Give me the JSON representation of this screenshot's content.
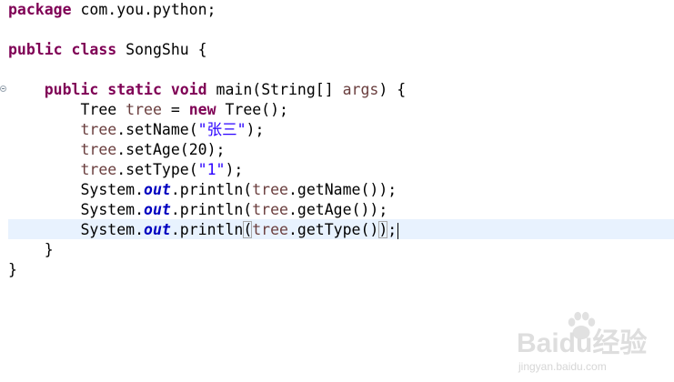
{
  "editor": {
    "lines": [
      {
        "segments": [
          {
            "t": "package",
            "c": "kw"
          },
          {
            "t": " com.you.python;",
            "c": "plain"
          }
        ]
      },
      {
        "segments": []
      },
      {
        "segments": [
          {
            "t": "public",
            "c": "kw"
          },
          {
            "t": " ",
            "c": "plain"
          },
          {
            "t": "class",
            "c": "kw"
          },
          {
            "t": " SongShu {",
            "c": "plain"
          }
        ]
      },
      {
        "segments": []
      },
      {
        "segments": [
          {
            "t": "    ",
            "c": "plain"
          },
          {
            "t": "public",
            "c": "kw"
          },
          {
            "t": " ",
            "c": "plain"
          },
          {
            "t": "static",
            "c": "kw"
          },
          {
            "t": " ",
            "c": "plain"
          },
          {
            "t": "void",
            "c": "kw"
          },
          {
            "t": " main(String[] ",
            "c": "plain"
          },
          {
            "t": "args",
            "c": "field"
          },
          {
            "t": ") {",
            "c": "plain"
          }
        ]
      },
      {
        "segments": [
          {
            "t": "        Tree ",
            "c": "plain"
          },
          {
            "t": "tree",
            "c": "field"
          },
          {
            "t": " = ",
            "c": "plain"
          },
          {
            "t": "new",
            "c": "kw"
          },
          {
            "t": " Tree();",
            "c": "plain"
          }
        ]
      },
      {
        "segments": [
          {
            "t": "        ",
            "c": "plain"
          },
          {
            "t": "tree",
            "c": "field"
          },
          {
            "t": ".setName(",
            "c": "plain"
          },
          {
            "t": "\"张三\"",
            "c": "str"
          },
          {
            "t": ");",
            "c": "plain"
          }
        ]
      },
      {
        "segments": [
          {
            "t": "        ",
            "c": "plain"
          },
          {
            "t": "tree",
            "c": "field"
          },
          {
            "t": ".setAge(20);",
            "c": "plain"
          }
        ]
      },
      {
        "segments": [
          {
            "t": "        ",
            "c": "plain"
          },
          {
            "t": "tree",
            "c": "field"
          },
          {
            "t": ".setType(",
            "c": "plain"
          },
          {
            "t": "\"1\"",
            "c": "str"
          },
          {
            "t": ");",
            "c": "plain"
          }
        ]
      },
      {
        "segments": [
          {
            "t": "        System.",
            "c": "plain"
          },
          {
            "t": "out",
            "c": "static-field"
          },
          {
            "t": ".println(",
            "c": "plain"
          },
          {
            "t": "tree",
            "c": "field"
          },
          {
            "t": ".getName());",
            "c": "plain"
          }
        ]
      },
      {
        "segments": [
          {
            "t": "        System.",
            "c": "plain"
          },
          {
            "t": "out",
            "c": "static-field"
          },
          {
            "t": ".println(",
            "c": "plain"
          },
          {
            "t": "tree",
            "c": "field"
          },
          {
            "t": ".getAge());",
            "c": "plain"
          }
        ]
      },
      {
        "segments": [
          {
            "t": "        System.",
            "c": "plain"
          },
          {
            "t": "out",
            "c": "static-field"
          },
          {
            "t": ".println",
            "c": "plain"
          },
          {
            "t": "(",
            "c": "plain"
          },
          {
            "t": "tree",
            "c": "field"
          },
          {
            "t": ".getType()",
            "c": "plain"
          },
          {
            "t": ")",
            "c": "plain"
          },
          {
            "t": ";",
            "c": "plain"
          }
        ]
      },
      {
        "segments": [
          {
            "t": "    }",
            "c": "plain"
          }
        ]
      },
      {
        "segments": [
          {
            "t": "}",
            "c": "plain"
          }
        ]
      }
    ],
    "current_line_index": 11
  },
  "watermark": {
    "brand": "Baidu经验",
    "sub": "jingyan.baidu.com"
  },
  "colors": {
    "keyword": "#7f0055",
    "field": "#6a3e3e",
    "string": "#2a00ff",
    "static_field": "#0000c0",
    "current_line": "#e8f2fe"
  }
}
